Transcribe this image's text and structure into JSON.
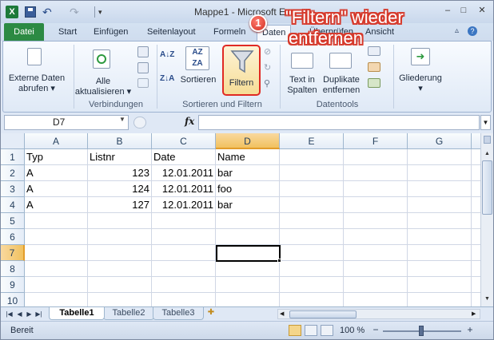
{
  "window": {
    "title": "Mappe1 - Microsoft Ex",
    "quick_access": {
      "app_glyph": "X",
      "undo_glyph": "↶",
      "redo_glyph": "↷",
      "customize_glyph": "▾"
    },
    "controls": {
      "minimize": "–",
      "maximize": "□",
      "close": "✕"
    }
  },
  "ribbon_tabs": [
    "Datei",
    "Start",
    "Einfügen",
    "Seitenlayout",
    "Formeln",
    "Daten",
    "Überprüfen",
    "Ansicht"
  ],
  "ribbon": {
    "external_data": {
      "label": "Externe Daten\nabrufen ▾"
    },
    "refresh_all": {
      "label": "Alle\naktualisieren ▾"
    },
    "connections_group": "Verbindungen",
    "sort_az_glyph": "A↓Z",
    "sort_za_glyph": "Z↓A",
    "sort": {
      "label": "Sortieren"
    },
    "filter": {
      "label": "Filtern"
    },
    "sort_filter_group": "Sortieren und Filtern",
    "text_to_columns": {
      "label": "Text in\nSpalten"
    },
    "remove_duplicates": {
      "label": "Duplikate\nentfernen"
    },
    "datatools_group": "Datentools",
    "outline": {
      "label": "Gliederung\n▾"
    }
  },
  "annotation": {
    "number": "1",
    "line1": "\"Filtern\" wieder",
    "line2": "entfernen"
  },
  "formula_bar": {
    "name_box": "D7",
    "fx": "fx",
    "content": ""
  },
  "grid": {
    "columns": [
      "A",
      "B",
      "C",
      "D",
      "E",
      "F",
      "G"
    ],
    "selected_column": "D",
    "rows": [
      "1",
      "2",
      "3",
      "4",
      "5",
      "6",
      "7",
      "8",
      "9",
      "10"
    ],
    "selected_row": "7",
    "cells": {
      "A1": "Typ",
      "B1": "Listnr",
      "C1": "Date",
      "D1": "Name",
      "A2": "A",
      "B2": "123",
      "C2": "12.01.2011",
      "D2": "bar",
      "A3": "A",
      "B3": "124",
      "C3": "12.01.2011",
      "D3": "foo",
      "A4": "A",
      "B4": "127",
      "C4": "12.01.2011",
      "D4": "bar"
    }
  },
  "sheet_tabs": [
    "Tabelle1",
    "Tabelle2",
    "Tabelle3"
  ],
  "active_sheet": "Tabelle1",
  "status_bar": {
    "status": "Bereit",
    "zoom": "100 %",
    "zoom_minus": "−",
    "zoom_plus": "+"
  },
  "colors": {
    "file_tab": "#2c8a43",
    "annotation": "#d63a2c",
    "selected_header": "#f1c15f"
  }
}
